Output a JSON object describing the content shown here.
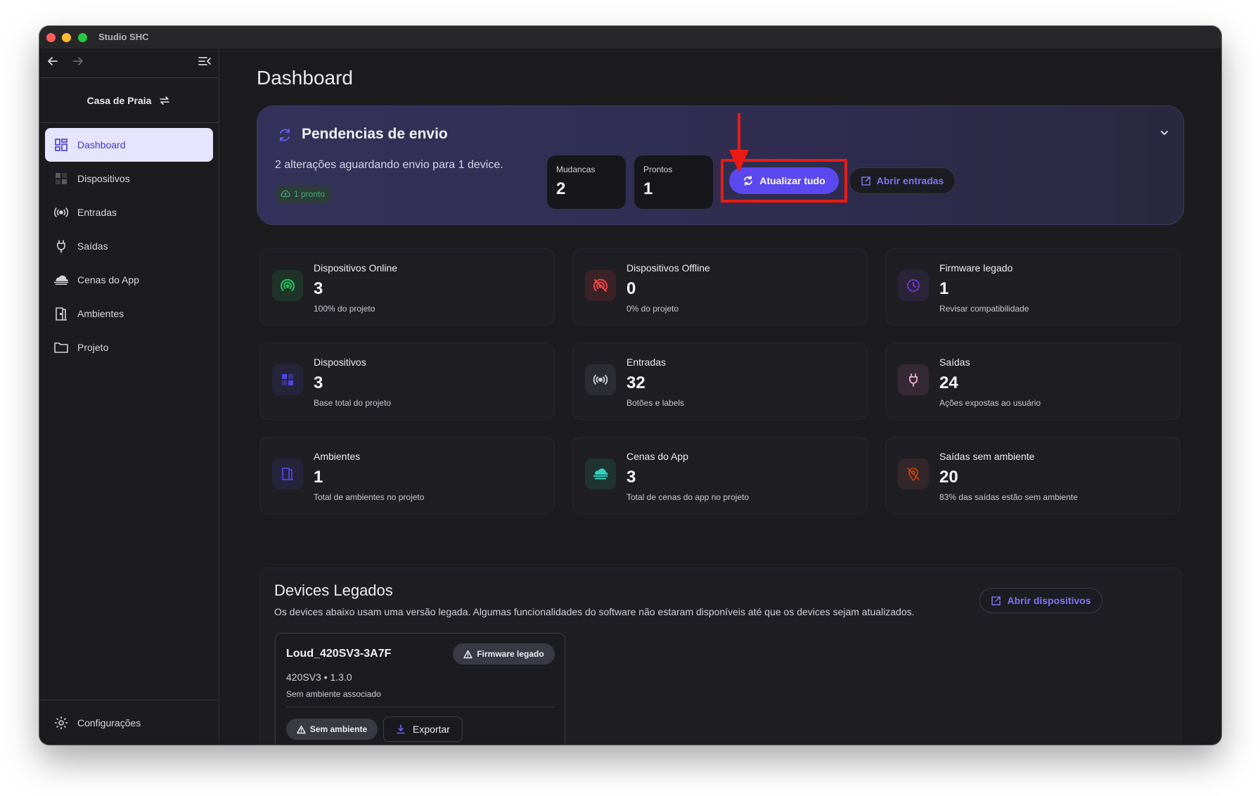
{
  "window": {
    "title": "Studio SHC"
  },
  "sidebar": {
    "project": "Casa de Praia",
    "items": [
      {
        "label": "Dashboard",
        "icon": "dashboard-icon",
        "active": true
      },
      {
        "label": "Dispositivos",
        "icon": "devices-icon",
        "active": false
      },
      {
        "label": "Entradas",
        "icon": "broadcast-icon",
        "active": false
      },
      {
        "label": "Saídas",
        "icon": "plug-icon",
        "active": false
      },
      {
        "label": "Cenas do App",
        "icon": "cloud-scene-icon",
        "active": false
      },
      {
        "label": "Ambientes",
        "icon": "door-icon",
        "active": false
      },
      {
        "label": "Projeto",
        "icon": "folder-icon",
        "active": false
      }
    ],
    "settings_label": "Configurações"
  },
  "main": {
    "title": "Dashboard",
    "pending": {
      "title": "Pendencias de envio",
      "description": "2 alterações aguardando envio para 1 device.",
      "ready_chip": "1 pronto",
      "changes_label": "Mudancas",
      "changes_value": "2",
      "ready_label": "Prontos",
      "ready_value": "1",
      "update_button": "Atualizar tudo",
      "entries_button": "Abrir entradas"
    },
    "cards": [
      {
        "title": "Dispositivos Online",
        "value": "3",
        "subtitle": "100% do projeto",
        "icon": "signal-online-icon",
        "color": "#22c55e"
      },
      {
        "title": "Dispositivos Offline",
        "value": "0",
        "subtitle": "0% do projeto",
        "icon": "signal-offline-icon",
        "color": "#ef4444"
      },
      {
        "title": "Firmware legado",
        "value": "1",
        "subtitle": "Revisar compatibilidade",
        "icon": "history-icon",
        "color": "#7c3aed"
      },
      {
        "title": "Dispositivos",
        "value": "3",
        "subtitle": "Base total do projeto",
        "icon": "devices-icon",
        "color": "#4f46e5"
      },
      {
        "title": "Entradas",
        "value": "32",
        "subtitle": "Botões e labels",
        "icon": "broadcast-icon",
        "color": "#d4d4d8"
      },
      {
        "title": "Saídas",
        "value": "24",
        "subtitle": "Ações expostas ao usuário",
        "icon": "plug-icon",
        "color": "#f9a8d4"
      },
      {
        "title": "Ambientes",
        "value": "1",
        "subtitle": "Total de ambientes no projeto",
        "icon": "door-icon",
        "color": "#4f46e5"
      },
      {
        "title": "Cenas do App",
        "value": "3",
        "subtitle": "Total de cenas do app no projeto",
        "icon": "cloud-scene-icon",
        "color": "#2dd4bf"
      },
      {
        "title": "Saídas sem ambiente",
        "value": "20",
        "subtitle": "83% das saídas estão sem ambiente",
        "icon": "no-location-icon",
        "color": "#c2410c"
      }
    ],
    "legacy": {
      "title": "Devices Legados",
      "description": "Os devices abaixo usam uma versão legada. Algumas funcionalidades do software não estaram disponíveis até que os devices sejam atualizados.",
      "open_button": "Abrir dispositivos",
      "device": {
        "name": "Loud_420SV3-3A7F",
        "badge": "Firmware legado",
        "model": "420SV3 • 1.3.0",
        "room": "Sem ambiente associado",
        "no_room_chip": "Sem ambiente",
        "export_button": "Exportar"
      }
    }
  }
}
